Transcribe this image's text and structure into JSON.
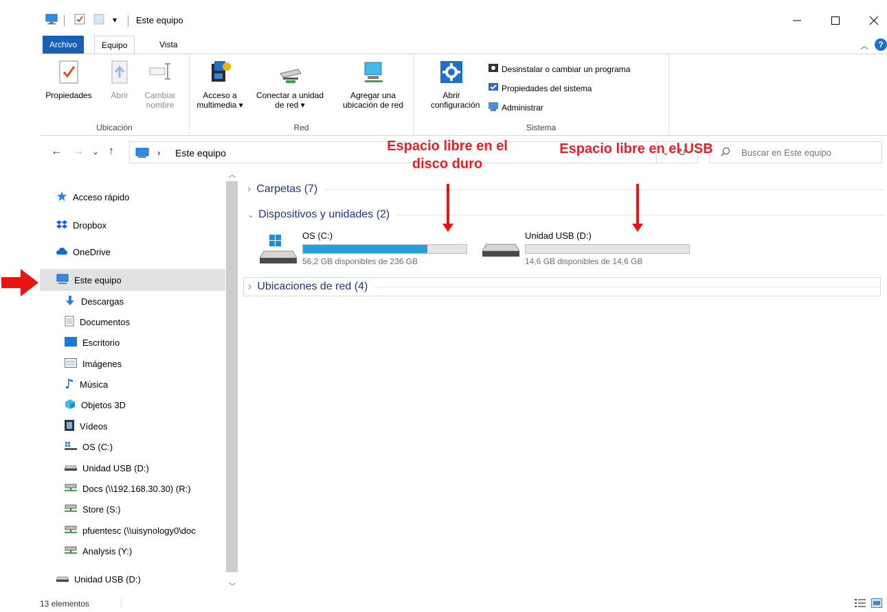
{
  "window": {
    "title": "Este equipo",
    "controls": [
      "minimize",
      "maximize",
      "close"
    ]
  },
  "tabs": [
    {
      "label": "Archivo"
    },
    {
      "label": "Equipo"
    },
    {
      "label": "Vista"
    }
  ],
  "ribbon": {
    "groups": [
      {
        "label": "Ubicación"
      },
      {
        "label": "Red"
      },
      {
        "label": "Sistema"
      }
    ],
    "ubicacion": [
      {
        "label": "Propiedades",
        "icon": "properties-icon"
      },
      {
        "label": "Abrir",
        "icon": "open-icon"
      },
      {
        "label": "Cambiar nombre",
        "icon": "rename-icon"
      }
    ],
    "red": [
      {
        "label": "Acceso a multimedia",
        "icon": "media-access-icon"
      },
      {
        "label": "Conectar a unidad de red",
        "icon": "map-drive-icon"
      },
      {
        "label": "Agregar una ubicación de red",
        "icon": "network-location-icon"
      }
    ],
    "sistema": {
      "open_settings": "Abrir configuración",
      "uninstall": "Desinstalar o cambiar un programa",
      "system_properties": "Propiedades del sistema",
      "manage": "Administrar"
    }
  },
  "address": {
    "path": "Este equipo",
    "search_placeholder": "Buscar en Este equipo"
  },
  "sidebar": {
    "items": [
      {
        "label": "Acceso rápido",
        "icon": "star-icon"
      },
      {
        "label": "Dropbox",
        "icon": "dropbox-icon"
      },
      {
        "label": "OneDrive",
        "icon": "cloud-icon"
      },
      {
        "label": "Este equipo",
        "icon": "computer-icon"
      },
      {
        "label": "Descargas",
        "icon": "download-icon"
      },
      {
        "label": "Documentos",
        "icon": "document-icon"
      },
      {
        "label": "Escritorio",
        "icon": "desktop-icon"
      },
      {
        "label": "Imágenes",
        "icon": "pictures-icon"
      },
      {
        "label": "Música",
        "icon": "music-icon"
      },
      {
        "label": "Objetos 3D",
        "icon": "cube-icon"
      },
      {
        "label": "Vídeos",
        "icon": "video-icon"
      },
      {
        "label": "OS (C:)",
        "icon": "windows-drive-icon"
      },
      {
        "label": "Unidad USB (D:)",
        "icon": "usb-drive-icon"
      },
      {
        "label": "Docs (\\\\192.168.30.30) (R:)",
        "icon": "network-drive-icon"
      },
      {
        "label": "Store (S:)",
        "icon": "network-drive-icon"
      },
      {
        "label": "pfuentesc (\\\\uisynology0\\doc",
        "icon": "network-drive-icon"
      },
      {
        "label": "Analysis (Y:)",
        "icon": "network-drive-icon"
      },
      {
        "label": "Unidad USB (D:)",
        "icon": "usb-drive-icon"
      }
    ]
  },
  "content": {
    "groups": [
      {
        "label": "Carpetas (7)",
        "expanded": false
      },
      {
        "label": "Dispositivos y unidades (2)",
        "expanded": true
      },
      {
        "label": "Ubicaciones de red (4)",
        "expanded": false
      }
    ],
    "drives": [
      {
        "name": "OS (C:)",
        "free": "56,2 GB disponibles de 236 GB",
        "used_fraction": 0.762,
        "bar_color": "#26a0da"
      },
      {
        "name": "Unidad USB (D:)",
        "free": "14,6 GB disponibles de 14,6 GB",
        "used_fraction": 0.0,
        "bar_color": "#26a0da"
      }
    ]
  },
  "annotations": {
    "hdd": "Espacio libre en el disco duro",
    "usb": "Espacio libre en el USB",
    "color": "#ee1c24"
  },
  "status": {
    "count": "13 elementos"
  },
  "colors": {
    "accent": "#1a5fb4",
    "selection": "#e2e2e2",
    "link": "#1e3287"
  }
}
